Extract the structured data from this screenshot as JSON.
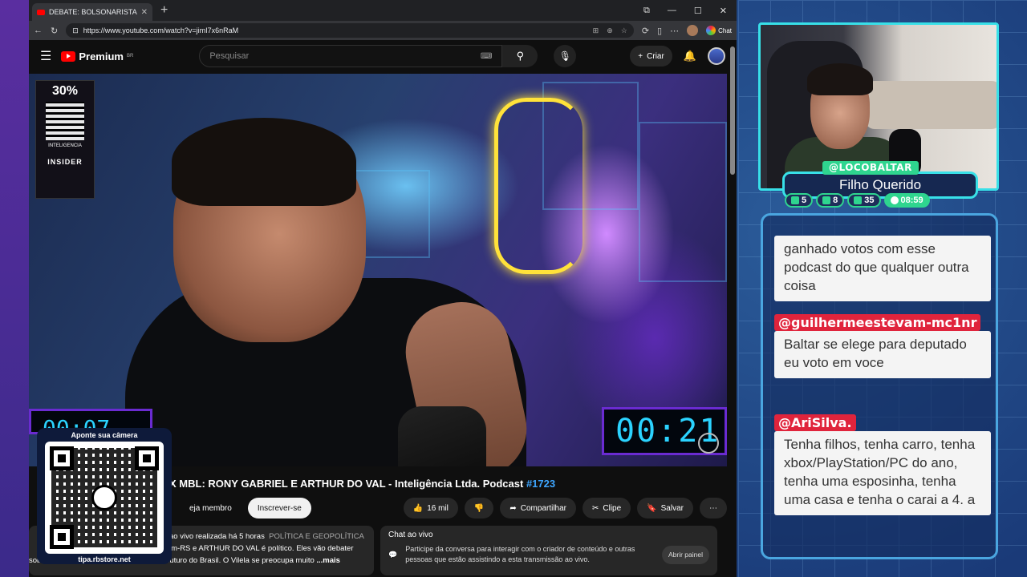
{
  "browser": {
    "tab_title": "DEBATE: BOLSONARISTA X MBL: R",
    "url": "https://www.youtube.com/watch?v=jimI7x6nRaM",
    "chat_label": "Chat"
  },
  "youtube": {
    "logo_text": "Premium",
    "region": "BR",
    "search_placeholder": "Pesquisar",
    "create_label": "Criar"
  },
  "video": {
    "sponsor_pct": "30%",
    "sponsor_tag": "INTELIGENCIA",
    "sponsor_brand": "INSIDER",
    "timer_right": "00:21",
    "timer_left": "00:07"
  },
  "info": {
    "title_main": "X MBL: RONY GABRIEL E ARTHUR DO VAL - Inteligência Ltda. Podcast ",
    "title_tag": "#1723",
    "member_label": "eja membro",
    "subscribe_label": "Inscrever-se",
    "likes": "16 mil",
    "share_label": "Compartilhar",
    "clip_label": "Clipe",
    "save_label": "Salvar"
  },
  "description": {
    "meta": "ao vivo realizada há 5 horas",
    "category": "POLÍTICA E GEOPOLÍTICA",
    "line2": "im-RS e ARTHUR DO VAL é político. Eles vão debater",
    "line3": "sobre Bolsonaro, a política da direita e o futuro do Brasil. O Vilela se preocupa muito",
    "more": "...mais"
  },
  "live_chat": {
    "heading": "Chat ao vivo",
    "body": "Participe da conversa para interagir com o criador de conteúdo e outras pessoas que estão assistindo a esta transmissão ao vivo.",
    "open_label": "Abrir painel"
  },
  "qr_overlay": {
    "caption": "Aponte sua câmera",
    "site": "tipa.rbstore.net"
  },
  "streamer": {
    "handle": "@LOCOBALTAR",
    "subtitle": "Filho Querido",
    "stats": [
      "5",
      "8",
      "35",
      "08:59"
    ]
  },
  "chat_messages": [
    {
      "user": "",
      "text": "ganhado votos com esse podcast do que qualquer outra coisa"
    },
    {
      "user": "@guilhermeestevam-mc1nr",
      "text": "Baltar se elege para deputado eu voto em voce"
    },
    {
      "user": "@AriSilva.",
      "text": "Tenha filhos, tenha carro, tenha xbox/PlayStation/PC do ano, tenha uma esposinha, tenha uma casa e tenha o carai a 4. a"
    }
  ],
  "colors": {
    "accent_cyan": "#38e0e8",
    "accent_green": "#2fd58f",
    "user_red": "#e0243c",
    "yt_red": "#ff0000"
  }
}
